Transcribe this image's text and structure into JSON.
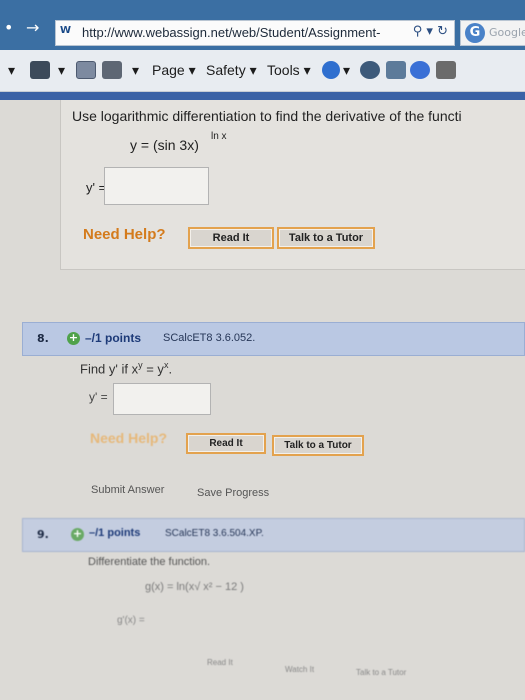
{
  "browser": {
    "url": "http://www.webassign.net/web/Student/Assignment-",
    "search_label": "Google",
    "toolbar": {
      "page": "Page ▾",
      "safety": "Safety ▾",
      "tools": "Tools ▾"
    }
  },
  "question7": {
    "prompt": "Use logarithmic differentiation to find the derivative of the functi",
    "equation": "y = (sin 3x)",
    "exponent": "ln x",
    "answer_label": "y' =",
    "answer_value": "",
    "need_help": "Need Help?",
    "read_it": "Read It",
    "talk_tutor": "Talk to a Tutor"
  },
  "question8": {
    "number": "8.",
    "points": "–/1 points",
    "course": "SCalcET8 3.6.052.",
    "prompt": "Find  y'  if  x",
    "exp1": "y",
    "mid": " = y",
    "exp2": "x",
    "end": ".",
    "answer_label": "y' =",
    "answer_value": "",
    "need_help": "Need Help?",
    "read_it": "Read It",
    "talk_tutor": "Talk to a Tutor",
    "submit": "Submit Answer",
    "save": "Save Progress"
  },
  "question9": {
    "number": "9.",
    "points": "–/1 points",
    "course": "SCalcET8 3.6.504.XP.",
    "prompt": "Differentiate the function.",
    "function": "g(x) = ln(x√ x² − 12 )",
    "answer_label": "g'(x) =",
    "read_it": "Read It",
    "watch_it": "Watch It",
    "talk_tutor": "Talk to a Tutor"
  }
}
